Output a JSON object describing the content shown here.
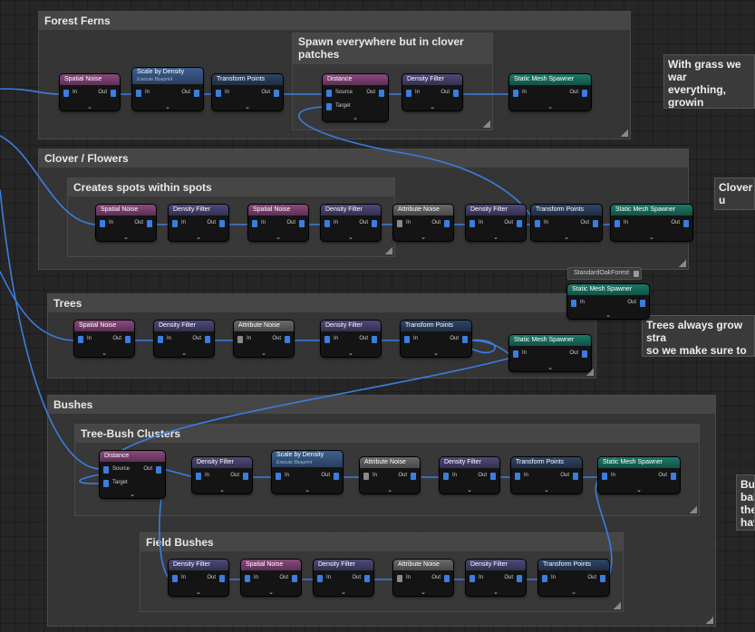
{
  "comments": {
    "forest_ferns": "Forest Ferns",
    "spawn_everywhere": "Spawn everywhere but in clover\npatches",
    "clover_flowers": "Clover / Flowers",
    "creates_spots": "Creates spots within spots",
    "trees": "Trees",
    "bushes": "Bushes",
    "tree_bush_clusters": "Tree-Bush Clusters",
    "field_bushes": "Field Bushes"
  },
  "notes": {
    "grass": "With grass we war\neverything, growin\npatches. Easy to d\nthem.",
    "clover": "Clover u\nwavey p",
    "trees": "Trees always grow stra\nso we make sure to app\nalways grow straight u",
    "bushes": "Bu\nbab\nthe\nhav"
  },
  "pins": {
    "in": "In",
    "out": "Out",
    "source": "Source",
    "target": "Target"
  },
  "nodes": {
    "spatial_noise": "Spatial Noise",
    "scale_by_density": "Scale by Density",
    "scale_sub": "Execute Blueprint",
    "transform_points": "Transform Points",
    "distance": "Distance",
    "density_filter": "Density Filter",
    "static_mesh_spawner": "Static Mesh Spawner",
    "attribute_noise": "Attribute Noise"
  },
  "floating": {
    "standard_oak_forest": "StandardOakForest"
  },
  "icons": {
    "pin": "pin-connector-icon",
    "expand": "chevron-down-icon",
    "resize": "resize-grip-icon"
  },
  "colors": {
    "wire": "#3b7de0",
    "spatial_noise_header": "#8a4b7d",
    "density_filter_header": "#4e4a7a",
    "spawner_header": "#1d7a69",
    "attribute_noise_header": "#6a6a6a"
  }
}
